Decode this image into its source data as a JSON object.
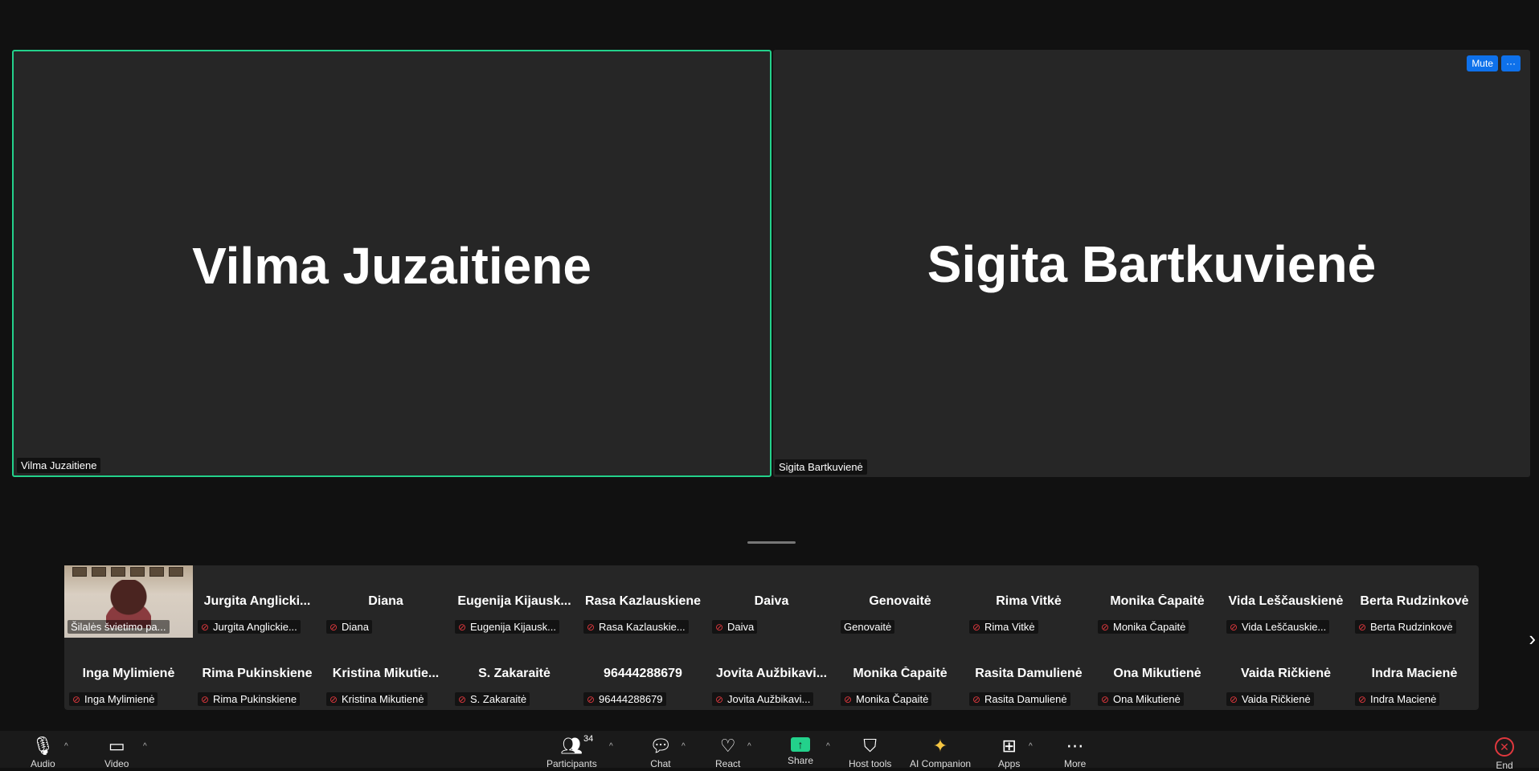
{
  "tiles": {
    "left": {
      "big_name": "Vilma Juzaitiene",
      "label": "Vilma Juzaitiene"
    },
    "right": {
      "big_name": "Sigita Bartkuvienė",
      "label": "Sigita Bartkuvienė",
      "mute_label": "Mute",
      "more_label": "···"
    }
  },
  "strip": {
    "video_participant_label": "Šilalės švietimo pa...",
    "row1": [
      {
        "name": "Jurgita  Anglicki...",
        "label": "Jurgita Anglickie...",
        "muted": true
      },
      {
        "name": "Diana",
        "label": "Diana",
        "muted": true
      },
      {
        "name": "Eugenija  Kijausk...",
        "label": "Eugenija Kijausk...",
        "muted": true
      },
      {
        "name": "Rasa Kazlauskiene",
        "label": "Rasa Kazlauskie...",
        "muted": true
      },
      {
        "name": "Daiva",
        "label": "Daiva",
        "muted": true
      },
      {
        "name": "Genovaitė",
        "label": "Genovaitė",
        "muted": false
      },
      {
        "name": "Rima Vitkė",
        "label": "Rima Vitkė",
        "muted": true
      },
      {
        "name": "Monika Čapaitė",
        "label": "Monika Čapaitė",
        "muted": true
      },
      {
        "name": "Vida Leščauskienė",
        "label": "Vida Leščauskie...",
        "muted": true
      },
      {
        "name": "Berta Rudzinkovė",
        "label": "Berta Rudzinkovė",
        "muted": true
      }
    ],
    "row2": [
      {
        "name": "Inga Mylimienė",
        "label": "Inga Mylimienė",
        "muted": true
      },
      {
        "name": "Rima Pukinskiene",
        "label": "Rima Pukinskiene",
        "muted": true
      },
      {
        "name": "Kristina  Mikutie...",
        "label": "Kristina Mikutienė",
        "muted": true
      },
      {
        "name": "S. Zakaraitė",
        "label": "S. Zakaraitė",
        "muted": true
      },
      {
        "name": "96444288679",
        "label": "96444288679",
        "muted": true
      },
      {
        "name": "Jovita  Aužbikavi...",
        "label": "Jovita Aužbikavi...",
        "muted": true
      },
      {
        "name": "Monika Čapaitė",
        "label": "Monika Čapaitė",
        "muted": true
      },
      {
        "name": "Rasita Damulienė",
        "label": "Rasita Damulienė",
        "muted": true
      },
      {
        "name": "Ona Mikutienė",
        "label": "Ona Mikutienė",
        "muted": true
      },
      {
        "name": "Vaida Ričkienė",
        "label": "Vaida Ričkienė",
        "muted": true
      },
      {
        "name": "Indra Macienė",
        "label": "Indra Macienė",
        "muted": true
      }
    ]
  },
  "toolbar": {
    "audio": "Audio",
    "video": "Video",
    "participants": "Participants",
    "participants_count": "34",
    "chat": "Chat",
    "react": "React",
    "share": "Share",
    "host_tools": "Host tools",
    "ai_companion": "AI Companion",
    "apps": "Apps",
    "more": "More",
    "end": "End"
  },
  "colors": {
    "active_speaker_border": "#23d18b",
    "mute_button": "#0e71eb",
    "share_green": "#23d18b",
    "end_red": "#e0383e"
  }
}
